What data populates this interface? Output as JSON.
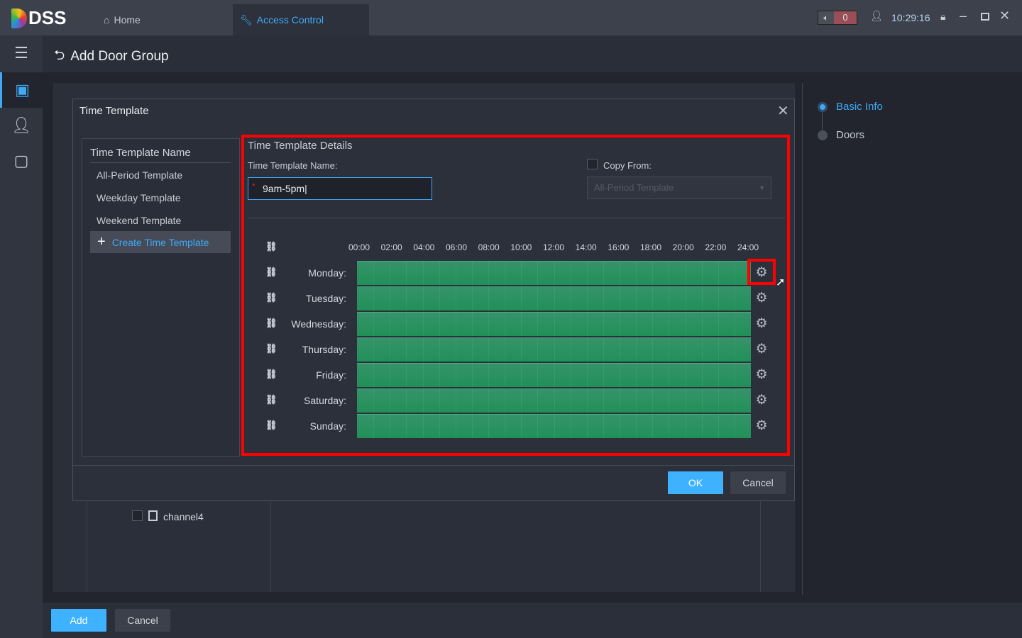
{
  "app": {
    "logo": "DSS",
    "tabs": [
      {
        "label": "Home",
        "icon": "home-icon"
      },
      {
        "label": "Access Control",
        "icon": "wrench-icon"
      }
    ],
    "alarm_count": "0",
    "time": "10:29:16"
  },
  "page": {
    "title": "Add Door Group",
    "steps": [
      "Basic Info",
      "Doors"
    ],
    "add_label": "Add",
    "cancel_label": "Cancel",
    "channel": "channel4"
  },
  "modal": {
    "title": "Time Template",
    "list_header": "Time Template Name",
    "templates": [
      "All-Period Template",
      "Weekday Template",
      "Weekend Template"
    ],
    "create_label": "Create Time Template",
    "details_title": "Time Template Details",
    "name_label": "Time Template Name:",
    "name_value": "9am-5pm",
    "copy_label": "Copy From:",
    "copy_value": "All-Period Template",
    "times": [
      "00:00",
      "02:00",
      "04:00",
      "06:00",
      "08:00",
      "10:00",
      "12:00",
      "14:00",
      "16:00",
      "18:00",
      "20:00",
      "22:00",
      "24:00"
    ],
    "days": [
      "Monday:",
      "Tuesday:",
      "Wednesday:",
      "Thursday:",
      "Friday:",
      "Saturday:",
      "Sunday:"
    ],
    "ok_label": "OK",
    "cancel_label": "Cancel"
  },
  "colors": {
    "accent": "#3fb2ff",
    "schedule": "#239a5e",
    "highlight": "#ff0000"
  }
}
